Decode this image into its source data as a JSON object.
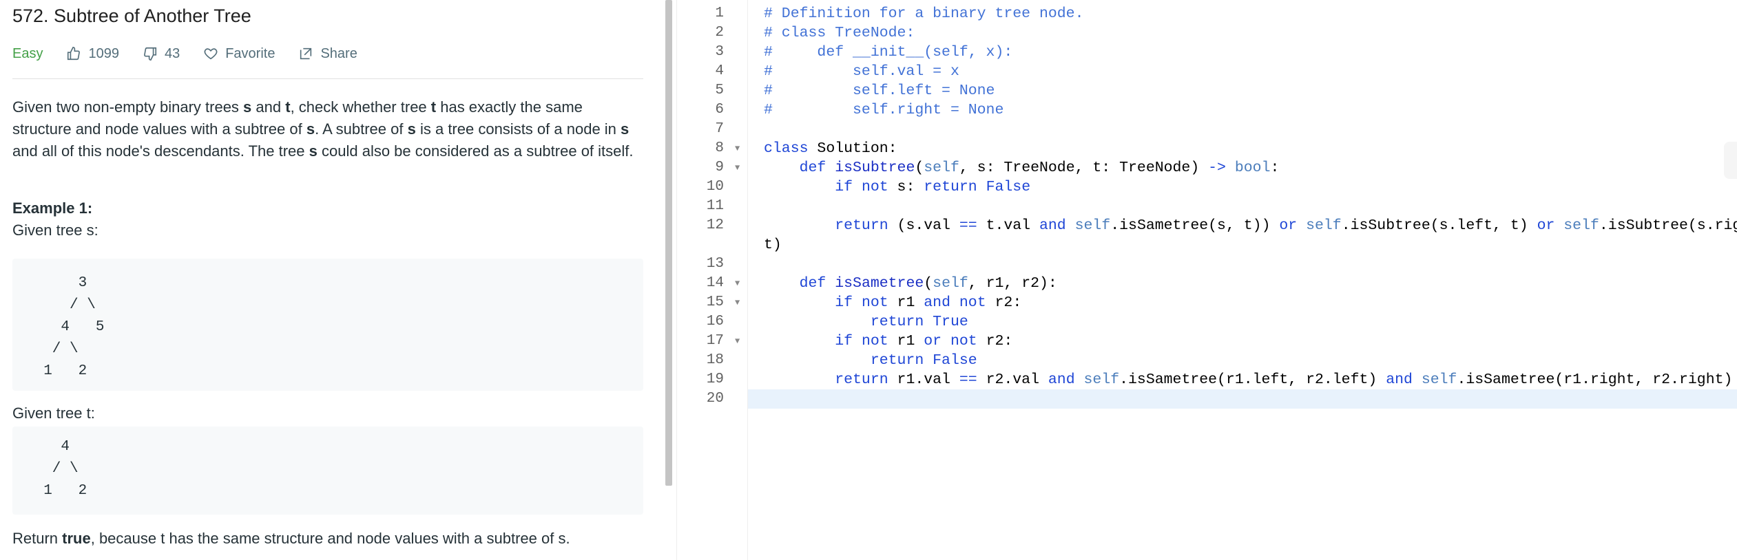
{
  "problem": {
    "title": "572. Subtree of Another Tree",
    "difficulty": "Easy",
    "likes": "1099",
    "dislikes": "43",
    "favorite_label": "Favorite",
    "share_label": "Share",
    "description_html": "Given two non-empty binary trees <b>s</b> and <b>t</b>, check whether tree <b>t</b> has exactly the same structure and node values with a subtree of <b>s</b>. A subtree of <b>s</b> is a tree consists of a node in <b>s</b> and all of this node's descendants. The tree <b>s</b> could also be considered as a subtree of itself.",
    "example_title": "Example 1:",
    "given_s_label": "Given tree s:",
    "tree_s": [
      "    3",
      "   / \\",
      "  4   5",
      " / \\",
      "1   2"
    ],
    "given_t_label": "Given tree t:",
    "tree_t": [
      "  4",
      " / \\",
      "1   2"
    ],
    "return_prefix": "Return ",
    "return_bold": "true",
    "return_suffix": ", because t has the same structure and node values with a subtree of s."
  },
  "editor": {
    "line_numbers": [
      "1",
      "2",
      "3",
      "4",
      "5",
      "6",
      "7",
      "8",
      "9",
      "10",
      "11",
      "12",
      "",
      "13",
      "14",
      "15",
      "16",
      "17",
      "18",
      "19",
      "20"
    ],
    "fold_lines": [
      8,
      9,
      14,
      15,
      17
    ],
    "code_lines": [
      "<span class='cm'># Definition for a binary tree node.</span>",
      "<span class='cm'># class TreeNode:</span>",
      "<span class='cm'>#     def __init__(self, x):</span>",
      "<span class='cm'>#         self.val = x</span>",
      "<span class='cm'>#         self.left = None</span>",
      "<span class='cm'>#         self.right = None</span>",
      "",
      "<span class='kw'>class</span> Solution:",
      "    <span class='kw'>def</span> <span class='fn'>isSubtree</span>(<span class='sf'>self</span>, s: TreeNode, t: TreeNode) <span class='kw'>-&gt;</span> <span class='sf'>bool</span>:",
      "        <span class='kw'>if</span> <span class='kw'>not</span> s: <span class='kw'>return</span> <span class='kw'>False</span>",
      "",
      "        <span class='kw'>return</span> (s.val <span class='kw'>==</span> t.val <span class='kw'>and</span> <span class='sf'>self</span>.isSametree(s, t)) <span class='kw'>or</span> <span class='sf'>self</span>.isSubtree(s.left, t) <span class='kw'>or</span> <span class='sf'>self</span>.isSubtree(s.right,",
      "t)",
      "",
      "    <span class='kw'>def</span> <span class='fn'>isSametree</span>(<span class='sf'>self</span>, r1, r2):",
      "        <span class='kw'>if</span> <span class='kw'>not</span> r1 <span class='kw'>and</span> <span class='kw'>not</span> r2:",
      "            <span class='kw'>return</span> <span class='kw'>True</span>",
      "        <span class='kw'>if</span> <span class='kw'>not</span> r1 <span class='kw'>or</span> <span class='kw'>not</span> r2:",
      "            <span class='kw'>return</span> <span class='kw'>False</span>",
      "        <span class='kw'>return</span> r1.val <span class='kw'>==</span> r2.val <span class='kw'>and</span> <span class='sf'>self</span>.isSametree(r1.left, r2.left) <span class='kw'>and</span> <span class='sf'>self</span>.isSametree(r1.right, r2.right)",
      ""
    ]
  }
}
